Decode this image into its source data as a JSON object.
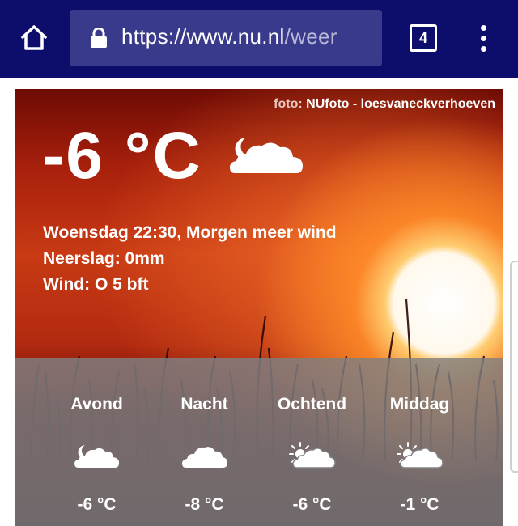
{
  "browser": {
    "url_host": "https://www.nu.nl",
    "url_path": "/weer",
    "tab_count": "4"
  },
  "weather": {
    "photo_credit_label": "foto:",
    "photo_credit_name": "NUfoto - loesvaneckverhoeven",
    "current_temp": "-6 °C",
    "current_icon": "moon-cloud-icon",
    "line1": "Woensdag 22:30, Morgen meer wind",
    "line2": "Neerslag: 0mm",
    "line3": "Wind: O 5 bft",
    "forecast": [
      {
        "label": "Avond",
        "icon": "moon-cloud-icon",
        "temp": "-6 °C"
      },
      {
        "label": "Nacht",
        "icon": "cloud-icon",
        "temp": "-8 °C"
      },
      {
        "label": "Ochtend",
        "icon": "sun-cloud-icon",
        "temp": "-6 °C"
      },
      {
        "label": "Middag",
        "icon": "sun-cloud-icon",
        "temp": "-1 °C"
      }
    ]
  }
}
